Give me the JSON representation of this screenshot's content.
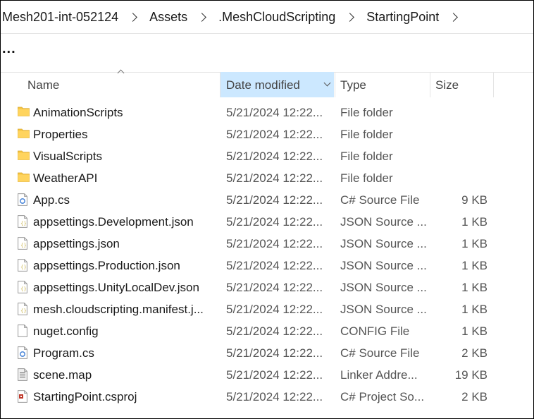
{
  "breadcrumb": [
    "Mesh201-int-052124",
    "Assets",
    ".MeshCloudScripting",
    "StartingPoint"
  ],
  "ellipsis": "...",
  "columns": {
    "name": "Name",
    "date": "Date modified",
    "type": "Type",
    "size": "Size"
  },
  "files": [
    {
      "name": "AnimationScripts",
      "date": "5/21/2024 12:22...",
      "type": "File folder",
      "size": "",
      "icon": "folder-icon"
    },
    {
      "name": "Properties",
      "date": "5/21/2024 12:22...",
      "type": "File folder",
      "size": "",
      "icon": "folder-icon"
    },
    {
      "name": "VisualScripts",
      "date": "5/21/2024 12:22...",
      "type": "File folder",
      "size": "",
      "icon": "folder-icon"
    },
    {
      "name": "WeatherAPI",
      "date": "5/21/2024 12:22...",
      "type": "File folder",
      "size": "",
      "icon": "folder-icon"
    },
    {
      "name": "App.cs",
      "date": "5/21/2024 12:22...",
      "type": "C# Source File",
      "size": "9 KB",
      "icon": "csharp-file-icon"
    },
    {
      "name": "appsettings.Development.json",
      "date": "5/21/2024 12:22...",
      "type": "JSON Source ...",
      "size": "1 KB",
      "icon": "json-file-icon"
    },
    {
      "name": "appsettings.json",
      "date": "5/21/2024 12:22...",
      "type": "JSON Source ...",
      "size": "1 KB",
      "icon": "json-file-icon"
    },
    {
      "name": "appsettings.Production.json",
      "date": "5/21/2024 12:22...",
      "type": "JSON Source ...",
      "size": "1 KB",
      "icon": "json-file-icon"
    },
    {
      "name": "appsettings.UnityLocalDev.json",
      "date": "5/21/2024 12:22...",
      "type": "JSON Source ...",
      "size": "1 KB",
      "icon": "json-file-icon"
    },
    {
      "name": "mesh.cloudscripting.manifest.j...",
      "date": "5/21/2024 12:22...",
      "type": "JSON Source ...",
      "size": "1 KB",
      "icon": "json-file-icon"
    },
    {
      "name": "nuget.config",
      "date": "5/21/2024 12:22...",
      "type": "CONFIG File",
      "size": "1 KB",
      "icon": "config-file-icon"
    },
    {
      "name": "Program.cs",
      "date": "5/21/2024 12:22...",
      "type": "C# Source File",
      "size": "2 KB",
      "icon": "csharp-file-icon"
    },
    {
      "name": "scene.map",
      "date": "5/21/2024 12:22...",
      "type": "Linker Addre...",
      "size": "19 KB",
      "icon": "map-file-icon"
    },
    {
      "name": "StartingPoint.csproj",
      "date": "5/21/2024 12:22...",
      "type": "C# Project So...",
      "size": "2 KB",
      "icon": "csproj-file-icon"
    }
  ],
  "colors": {
    "folder": "#f5c542",
    "selected_header": "#cce8ff",
    "csharp": "#3a7bd5",
    "csproj": "#c0392b",
    "json": "#c9b44a"
  }
}
